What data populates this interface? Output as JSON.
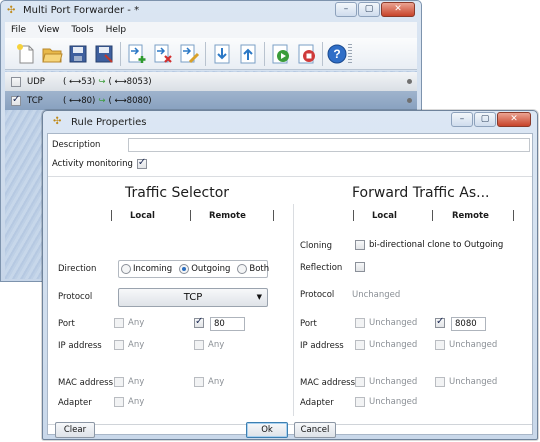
{
  "main": {
    "title": "Multi Port Forwarder - *",
    "window_buttons": {
      "minimize": "–",
      "maximize": "▢",
      "close": "✕"
    },
    "menu": [
      "File",
      "View",
      "Tools",
      "Help"
    ],
    "rules": [
      {
        "checked": false,
        "protocol": "UDP",
        "local": "( ⟷53)",
        "remote": "( ⟷8053)"
      },
      {
        "checked": true,
        "protocol": "TCP",
        "local": "( ⟷80)",
        "remote": "( ⟷8080)"
      }
    ]
  },
  "dialog": {
    "title": "Rule Properties",
    "description_label": "Description",
    "description_value": "",
    "activity_label": "Activity monitoring",
    "activity_checked": true,
    "selector": {
      "title": "Traffic Selector",
      "col_local": "Local",
      "col_remote": "Remote",
      "direction_label": "Direction",
      "direction_options": [
        "Incoming",
        "Outgoing",
        "Both"
      ],
      "direction_selected": "Outgoing",
      "protocol_label": "Protocol",
      "protocol_value": "TCP",
      "port_label": "Port",
      "port_local": "Any",
      "port_remote_value": "80",
      "ip_label": "IP address",
      "ip_local": "Any",
      "ip_remote": "Any",
      "mac_label": "MAC address",
      "mac_local": "Any",
      "mac_remote": "Any",
      "adapter_label": "Adapter",
      "adapter_local": "Any"
    },
    "forward": {
      "title": "Forward Traffic As...",
      "col_local": "Local",
      "col_remote": "Remote",
      "cloning_label": "Cloning",
      "cloning_option": "bi-directional clone to Outgoing",
      "reflection_label": "Reflection",
      "protocol_label": "Protocol",
      "protocol_value": "Unchanged",
      "port_label": "Port",
      "port_local": "Unchanged",
      "port_remote_value": "8080",
      "ip_label": "IP address",
      "ip_local": "Unchanged",
      "ip_remote": "Unchanged",
      "mac_label": "MAC address",
      "mac_local": "Unchanged",
      "mac_remote": "Unchanged",
      "adapter_label": "Adapter",
      "adapter_local": "Unchanged"
    },
    "buttons": {
      "clear": "Clear",
      "ok": "Ok",
      "cancel": "Cancel"
    }
  },
  "toolbar_icons": [
    "new-file-icon",
    "open-folder-icon",
    "save-icon",
    "save-as-icon",
    "add-rule-icon",
    "delete-rule-icon",
    "edit-rule-icon",
    "move-down-icon",
    "move-up-icon",
    "start-icon",
    "stop-icon",
    "help-icon"
  ]
}
